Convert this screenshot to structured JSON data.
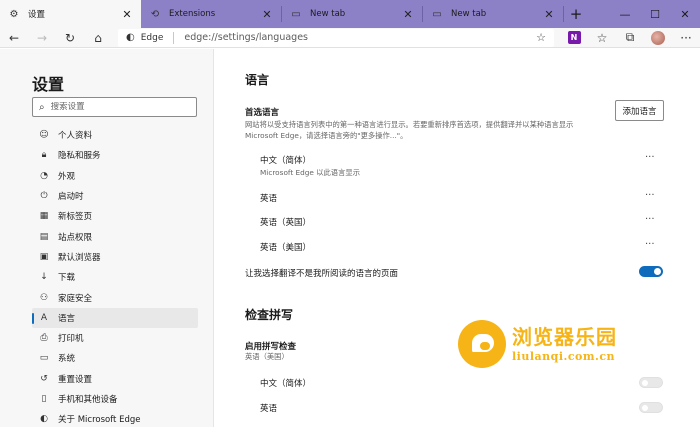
{
  "tabs": [
    {
      "title": "设置",
      "icon": "gear-icon",
      "active": true
    },
    {
      "title": "Extensions",
      "icon": "extensions-icon",
      "active": false
    },
    {
      "title": "New tab",
      "icon": "newtab-page-icon",
      "active": false
    },
    {
      "title": "New tab",
      "icon": "newtab-page-icon",
      "active": false
    }
  ],
  "toolbar": {
    "site_label": "Edge",
    "url": "edge://settings/languages"
  },
  "sidebar": {
    "title": "设置",
    "search_placeholder": "搜索设置",
    "items": [
      {
        "label": "个人资料",
        "icon": "profile-icon"
      },
      {
        "label": "隐私和服务",
        "icon": "lock-icon"
      },
      {
        "label": "外观",
        "icon": "appearance-icon"
      },
      {
        "label": "启动时",
        "icon": "power-icon"
      },
      {
        "label": "新标签页",
        "icon": "newtab-icon"
      },
      {
        "label": "站点权限",
        "icon": "site-permissions-icon"
      },
      {
        "label": "默认浏览器",
        "icon": "default-browser-icon"
      },
      {
        "label": "下载",
        "icon": "download-icon"
      },
      {
        "label": "家庭安全",
        "icon": "family-icon"
      },
      {
        "label": "语言",
        "icon": "language-icon",
        "selected": true
      },
      {
        "label": "打印机",
        "icon": "printer-icon"
      },
      {
        "label": "系统",
        "icon": "system-icon"
      },
      {
        "label": "重置设置",
        "icon": "reset-icon"
      },
      {
        "label": "手机和其他设备",
        "icon": "phone-icon"
      },
      {
        "label": "关于 Microsoft Edge",
        "icon": "edge-logo-icon"
      }
    ]
  },
  "main": {
    "language_section_title": "语言",
    "preferred_label": "首选语言",
    "preferred_desc_line1": "网站将以受支持语言列表中的第一种语言进行显示。若要重新排序首选项，提供翻译并以某种语言显示",
    "preferred_desc_line2": "Microsoft Edge，请选择语言旁的\"更多操作...\"。",
    "add_language_button": "添加语言",
    "languages": [
      {
        "name": "中文（简体）",
        "sub": "Microsoft Edge 以此语言显示"
      },
      {
        "name": "英语",
        "sub": ""
      },
      {
        "name": "英语（英国）",
        "sub": ""
      },
      {
        "name": "英语（美国）",
        "sub": ""
      }
    ],
    "more_actions": "···",
    "translate_label": "让我选择翻译不是我所阅读的语言的页面",
    "translate_on": true,
    "spellcheck_title": "检查拼写",
    "spellcheck_label": "启用拼写检查",
    "spellcheck_sub": "英语（美国）",
    "spell_languages": [
      {
        "name": "中文（简体）",
        "on": false
      },
      {
        "name": "英语",
        "on": false
      }
    ]
  },
  "watermark": {
    "text_cn": "浏览器乐园",
    "text_url": "liulanqi.com.cn"
  },
  "colors": {
    "titlebar": "#8c80c7",
    "accent": "#0f6cbd",
    "watermark": "#f6b417"
  }
}
